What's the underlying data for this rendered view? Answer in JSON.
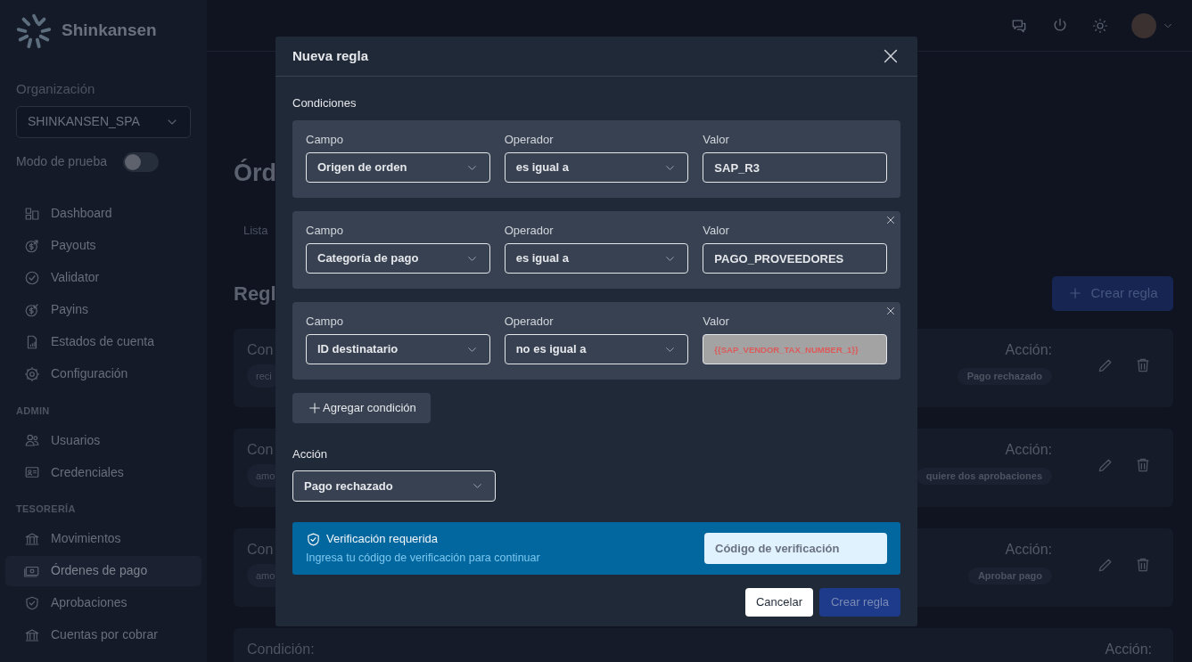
{
  "sidebar": {
    "brand": "Shinkansen",
    "org_label": "Organización",
    "org_select": "SHINKANSEN_SPA",
    "test_mode": {
      "label": "Modo de prueba",
      "on": false
    },
    "sections": [
      {
        "items": [
          {
            "label": "Dashboard",
            "selected": false
          },
          {
            "label": "Payouts",
            "selected": false
          },
          {
            "label": "Validator",
            "selected": false
          },
          {
            "label": "Payins",
            "selected": false
          },
          {
            "label": "Estados de cuenta",
            "selected": false
          },
          {
            "label": "Configuración",
            "selected": false
          }
        ]
      },
      {
        "heading": "ADMIN",
        "items": [
          {
            "label": "Usuarios",
            "selected": false
          },
          {
            "label": "Credenciales",
            "selected": false
          }
        ]
      },
      {
        "heading": "TESORERÍA",
        "items": [
          {
            "label": "Movimientos",
            "selected": false
          },
          {
            "label": "Órdenes de pago",
            "selected": true
          },
          {
            "label": "Aprobaciones",
            "selected": false
          },
          {
            "label": "Cuentas por cobrar",
            "selected": false
          }
        ]
      }
    ]
  },
  "page": {
    "title": "Órd",
    "tab": "Lista",
    "section_title": "Regl",
    "create_button": "Crear regla",
    "rules": [
      {
        "condition_label": "Con",
        "condition_chip": "reci",
        "action_label": "Acción:",
        "action_chip": "Pago rechazado"
      },
      {
        "condition_label": "Con",
        "condition_chip": "amo",
        "action_label": "Acción:",
        "action_chip": "quiere dos aprobaciones"
      },
      {
        "condition_label": "Con",
        "condition_chip": "amo",
        "action_label": "Acción:",
        "action_chip": "Aprobar pago"
      },
      {
        "condition_label": "Condición:",
        "action_label": "Acción:"
      }
    ]
  },
  "modal": {
    "title": "Nueva regla",
    "conditions_label": "Condiciones",
    "conditions": [
      {
        "field_label": "Campo",
        "field": "Origen de orden",
        "operator_label": "Operador",
        "operator": "es igual a",
        "value_label": "Valor",
        "value": "SAP_R3",
        "kind": "text",
        "removable": false
      },
      {
        "field_label": "Campo",
        "field": "Categoría de pago",
        "operator_label": "Operador",
        "operator": "es igual a",
        "value_label": "Valor",
        "value": "PAGO_PROVEEDORES",
        "kind": "text",
        "removable": true
      },
      {
        "field_label": "Campo",
        "field": "ID destinatario",
        "operator_label": "Operador",
        "operator": "no es igual a",
        "value_label": "Valor",
        "value": "{{SAP_VENDOR_TAX_NUMBER_1}}",
        "kind": "variable",
        "removable": true
      }
    ],
    "add_button": "Agregar condición",
    "action_label": "Acción",
    "action": "Pago rechazado",
    "verification": {
      "title": "Verificación requerida",
      "subtitle": "Ingresa tu código de verificación para continuar",
      "placeholder": "Código de verificación"
    },
    "cancel": "Cancelar",
    "submit": {
      "label": "Crear regla",
      "disabled": true
    }
  }
}
